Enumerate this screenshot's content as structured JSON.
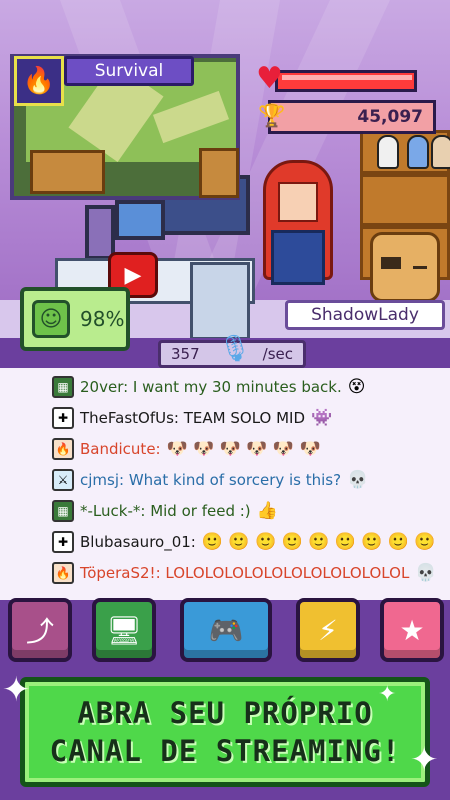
{
  "game_panel": {
    "title": "Survival",
    "icon": "torch-icon"
  },
  "stats": {
    "viewers": "45,097",
    "health_icon": "heart-icon",
    "viewers_icon": "trophy-icon"
  },
  "mood": {
    "value": "98%",
    "icon": "smiley-icon"
  },
  "streamer": {
    "name": "ShadowLady"
  },
  "rate": {
    "value": "357",
    "unit": "/sec",
    "icon": "microphone-icon"
  },
  "chat": [
    {
      "user": "20ver:",
      "text": " I want my 30 minutes back.",
      "user_color": "#2a5e1e",
      "text_color": "#2a5e1e",
      "emotes": "😵"
    },
    {
      "user": "TheFastOfUs:",
      "text": " TEAM SOLO MID",
      "user_color": "#1a1a1a",
      "text_color": "#1a1a1a",
      "emotes": "👾"
    },
    {
      "user": "Bandicute:",
      "text": "",
      "user_color": "#d8452b",
      "text_color": "#d8452b",
      "emotes": "🐶 🐶 🐶 🐶 🐶 🐶"
    },
    {
      "user": "cjmsj:",
      "text": " What kind of sorcery is this?",
      "user_color": "#2a6ea8",
      "text_color": "#2a6ea8",
      "emotes": "💀"
    },
    {
      "user": "*-Luck-*:",
      "text": " Mid or feed :)",
      "user_color": "#2a5e1e",
      "text_color": "#2a5e1e",
      "emotes": "👍"
    },
    {
      "user": "Blubasauro_01:",
      "text": "",
      "user_color": "#1a1a1a",
      "text_color": "#1a1a1a",
      "emotes": "🙂 🙂 🙂 🙂 🙂 🙂 🙂 🙂 🙂"
    },
    {
      "user": "TöperaS2!:",
      "text": " LOLOLOLOLOLOLOLOLOLOLOLOL",
      "user_color": "#d8452b",
      "text_color": "#d8452b",
      "emotes": "💀"
    }
  ],
  "nav": [
    {
      "name": "upgrade-button",
      "icon": "arrow-up-icon",
      "color": "#a8508a"
    },
    {
      "name": "computer-button",
      "icon": "monitor-icon",
      "color": "#3aa04a"
    },
    {
      "name": "games-button",
      "icon": "gamepad-icon",
      "color": "#3a9ad8"
    },
    {
      "name": "boost-button",
      "icon": "lightning-icon",
      "color": "#f0c030"
    },
    {
      "name": "favorites-button",
      "icon": "star-icon",
      "color": "#f06890"
    }
  ],
  "banner": {
    "line1": "ABRA SEU PRÓPRIO",
    "line2": "CANAL DE STREAMING!"
  }
}
